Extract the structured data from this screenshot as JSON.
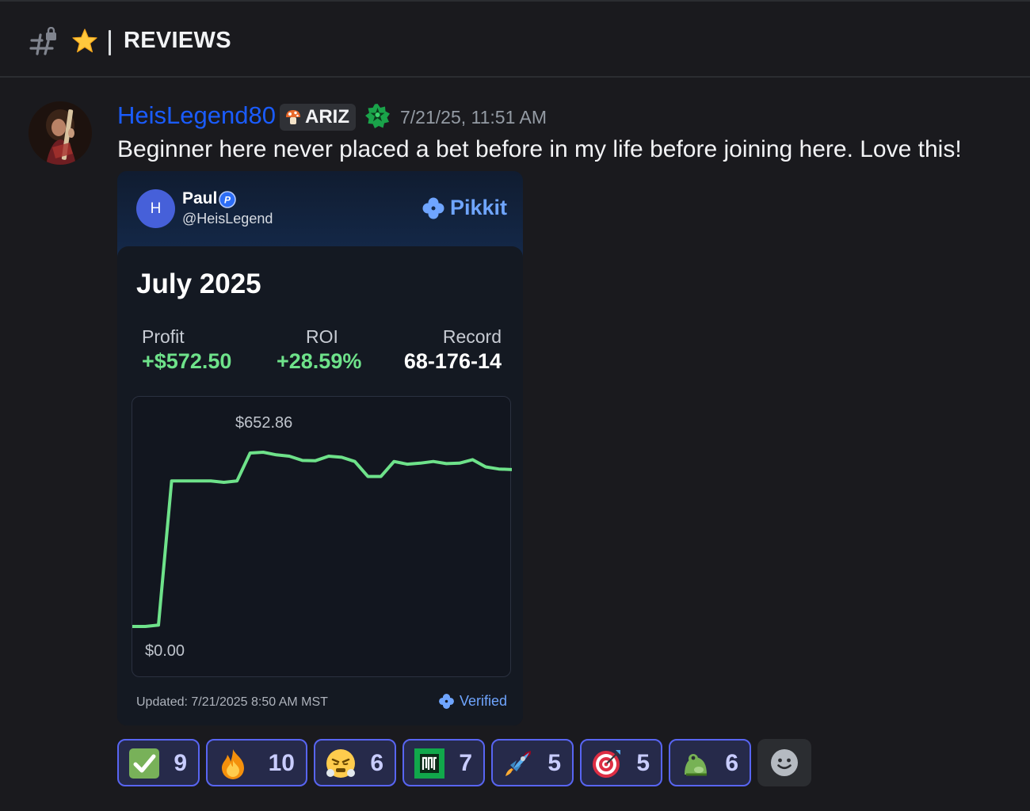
{
  "channel": {
    "name": "REVIEWS",
    "icon": "locked-hash-icon",
    "emoji": "star-icon"
  },
  "message": {
    "author": "HeisLegend80",
    "role_tag": "ARIZ",
    "role_emoji": "mushroom-icon",
    "timestamp": "7/21/25, 11:51 AM",
    "text": "Beginner here never placed a bet before in my life before joining here. Love this!",
    "author_color": "#1a5cff"
  },
  "card": {
    "avatar_letter": "H",
    "name": "Paul",
    "handle": "@HeisLegend",
    "brand": "Pikkit",
    "period": "July 2025",
    "stats": [
      {
        "label": "Profit",
        "value": "+$572.50"
      },
      {
        "label": "ROI",
        "value": "+28.59%"
      },
      {
        "label": "Record",
        "value": "68-176-14"
      }
    ],
    "updated": "Updated: 7/21/2025 8:50 AM MST",
    "verified_label": "Verified",
    "accent_color": "#6fa5ff",
    "positive_color": "#6ee28a"
  },
  "chart_data": {
    "type": "line",
    "title": "",
    "xlabel": "",
    "ylabel": "",
    "annotations": [
      "$652.86",
      "$0.00"
    ],
    "ylim": [
      0,
      652.86
    ],
    "series": [
      {
        "values": [
          0,
          0,
          5,
          545,
          545,
          545,
          545,
          540,
          545,
          650,
          652.86,
          643,
          638,
          622,
          621,
          638,
          634,
          618,
          562,
          562,
          618,
          608,
          612,
          618,
          610,
          612,
          625,
          598,
          590,
          588
        ]
      }
    ]
  },
  "reactions": [
    {
      "emoji": "check-mark-icon",
      "count": "9"
    },
    {
      "emoji": "fire-icon",
      "count": "10"
    },
    {
      "emoji": "steam-face-icon",
      "count": "6"
    },
    {
      "emoji": "server-logo-icon",
      "count": "7"
    },
    {
      "emoji": "rocket-icon",
      "count": "5"
    },
    {
      "emoji": "target-icon",
      "count": "5"
    },
    {
      "emoji": "frog-icon",
      "count": "6"
    }
  ]
}
